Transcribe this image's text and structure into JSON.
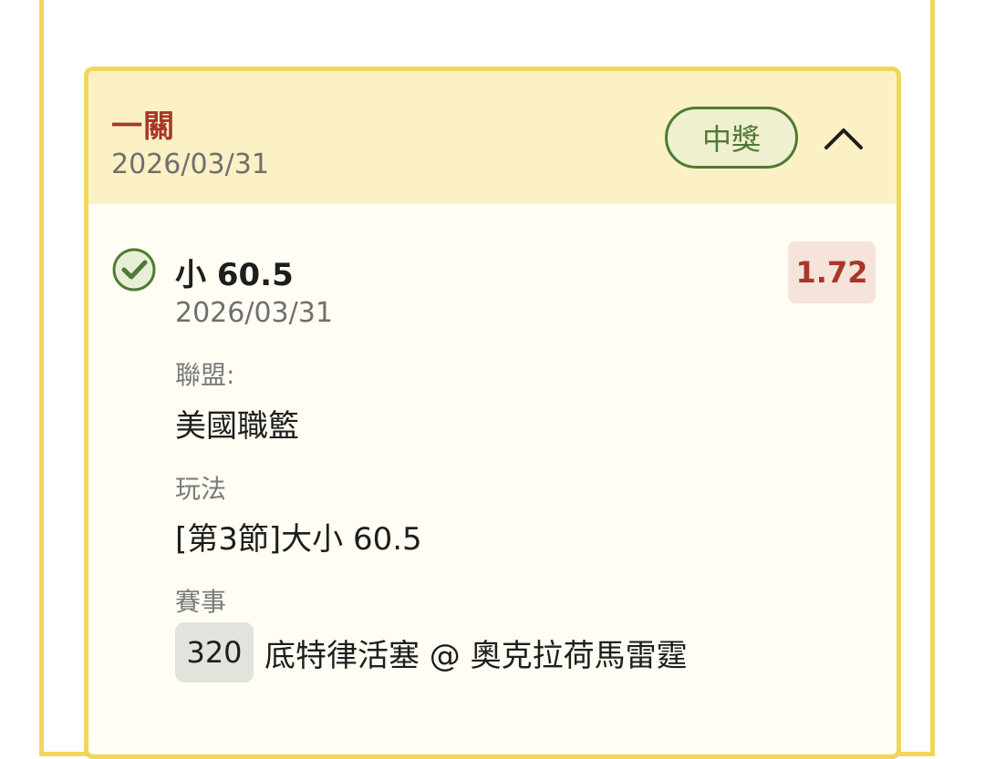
{
  "card": {
    "bet_type": "一關",
    "date": "2026/03/31",
    "status_badge": "中獎",
    "status_color": "#4f7a33",
    "collapse_icon": "chevron-up-icon"
  },
  "selection": {
    "result_icon": "check-circle-icon",
    "name": "小 60.5",
    "date": "2026/03/31",
    "odds": "1.72",
    "league_label": "聯盟:",
    "league": "美國職籃",
    "market_label": "玩法",
    "market": "[第3節]大小 60.5",
    "event_label": "賽事",
    "event_number": "320",
    "event_name": "底特律活塞 @ 奧克拉荷馬雷霆"
  },
  "colors": {
    "border": "#f2d65c",
    "header_bg": "#fcf1c5",
    "accent_red": "#a8372a",
    "win_green": "#4f7a33"
  }
}
